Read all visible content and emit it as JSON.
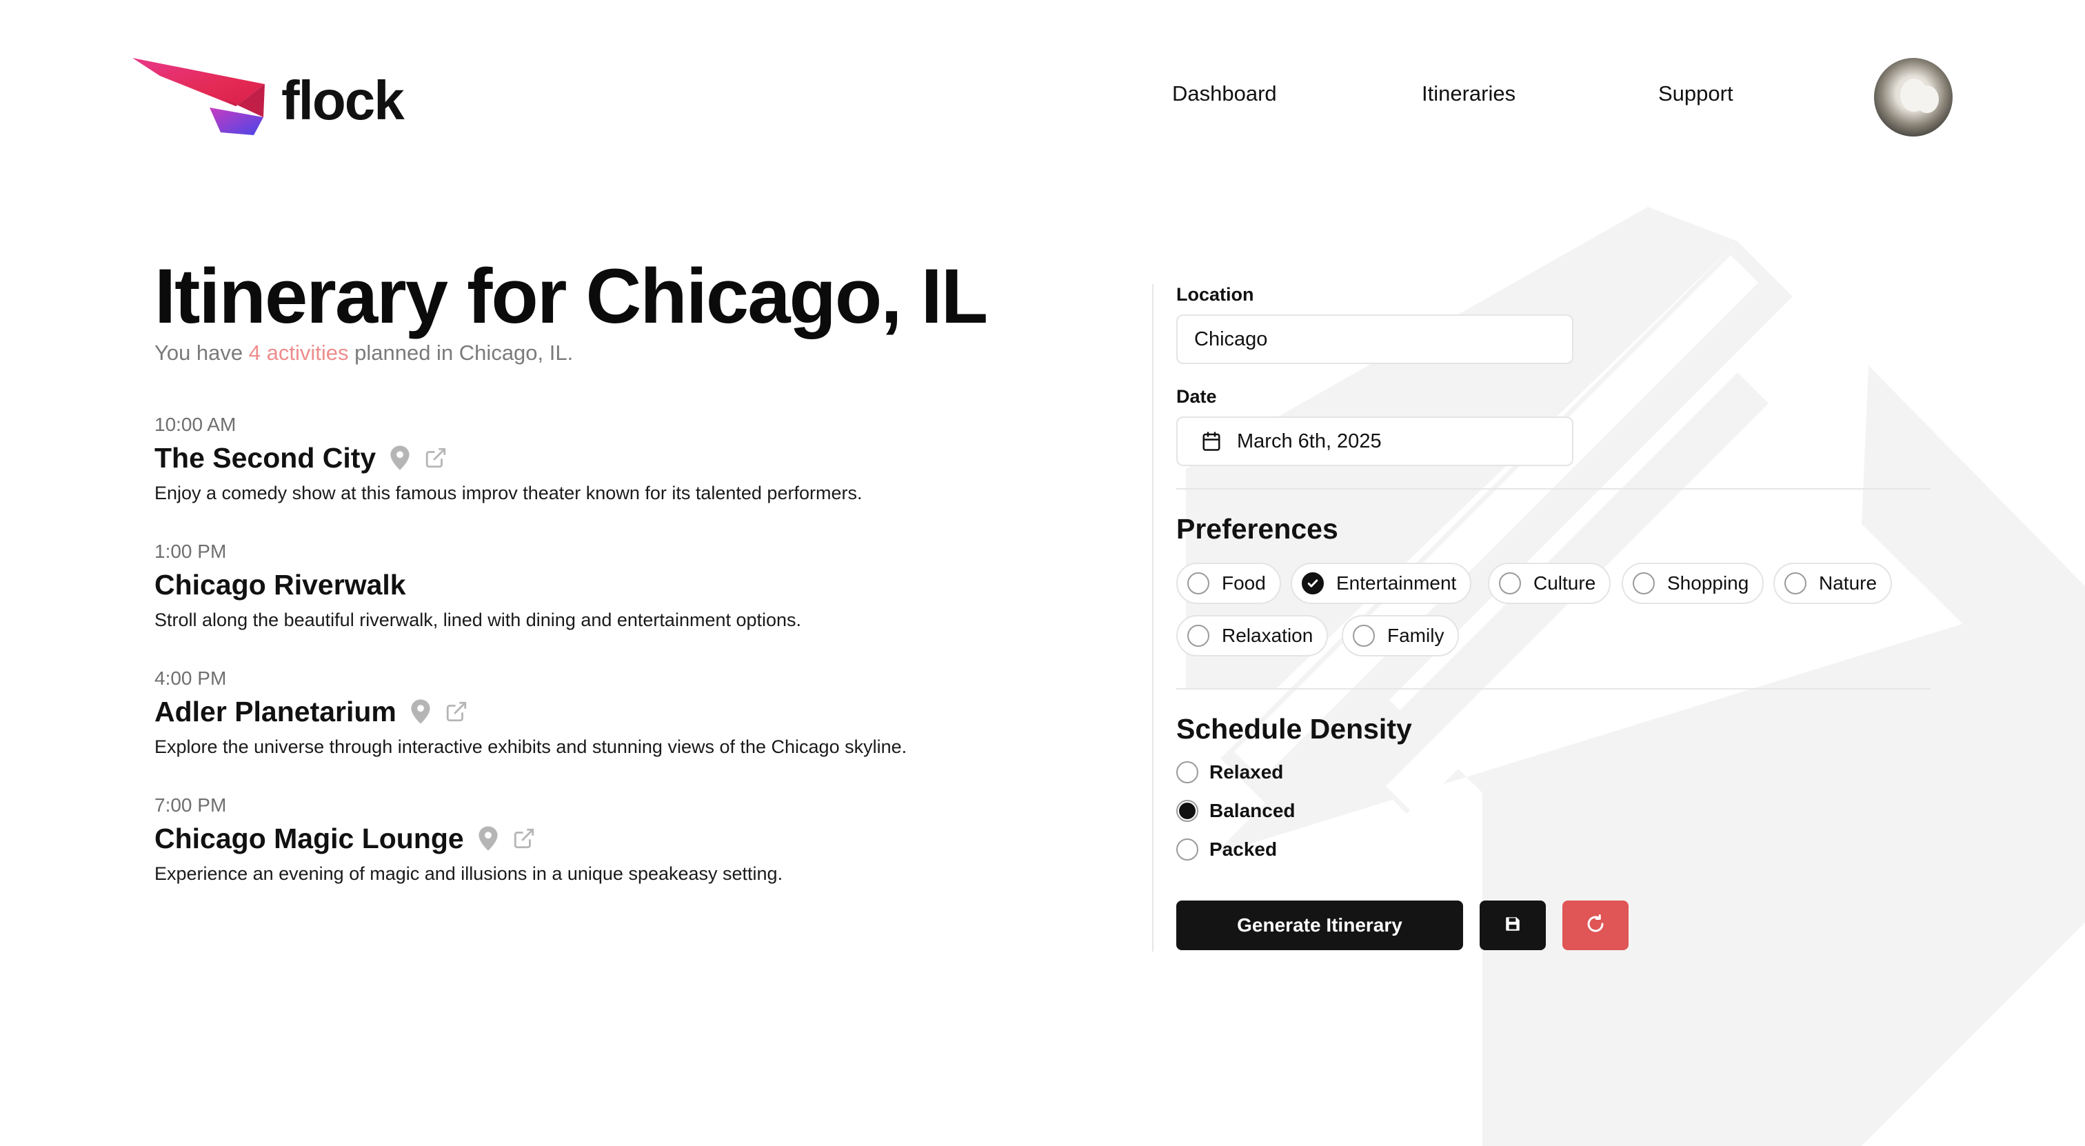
{
  "app": {
    "brand": "flock"
  },
  "nav": {
    "dashboard": "Dashboard",
    "itineraries": "Itineraries",
    "support": "Support"
  },
  "page": {
    "title": "Itinerary for Chicago, IL",
    "subtitle_prefix": "You have ",
    "subtitle_highlight": "4 activities",
    "subtitle_suffix": " planned in Chicago, IL."
  },
  "activities": [
    {
      "time": "10:00 AM",
      "name": "The Second City",
      "description": "Enjoy a comedy show at this famous improv theater known for its talented performers."
    },
    {
      "time": "1:00 PM",
      "name": "Chicago Riverwalk",
      "description": "Stroll along the beautiful riverwalk, lined with dining and entertainment options."
    },
    {
      "time": "4:00 PM",
      "name": "Adler Planetarium",
      "description": "Explore the universe through interactive exhibits and stunning views of the Chicago skyline."
    },
    {
      "time": "7:00 PM",
      "name": "Chicago Magic Lounge",
      "description": "Experience an evening of magic and illusions in a unique speakeasy setting."
    }
  ],
  "form": {
    "location_label": "Location",
    "location_value": "Chicago",
    "date_label": "Date",
    "date_value": "March 6th, 2025",
    "preferences_title": "Preferences",
    "preferences": [
      {
        "label": "Food",
        "checked": false
      },
      {
        "label": "Entertainment",
        "checked": true
      },
      {
        "label": "Culture",
        "checked": false
      },
      {
        "label": "Shopping",
        "checked": false
      },
      {
        "label": "Nature",
        "checked": false
      },
      {
        "label": "Relaxation",
        "checked": false
      },
      {
        "label": "Family",
        "checked": false
      }
    ],
    "density_title": "Schedule Density",
    "density_options": [
      {
        "label": "Relaxed",
        "selected": false
      },
      {
        "label": "Balanced",
        "selected": true
      },
      {
        "label": "Packed",
        "selected": false
      }
    ],
    "generate_label": "Generate Itinerary"
  },
  "icons": {
    "save": "floppy-disk-icon",
    "reset": "refresh-icon",
    "location": "map-pin-icon",
    "external": "external-link-icon",
    "calendar": "calendar-icon"
  },
  "colors": {
    "accent_red": "#e05555",
    "highlight": "#ee8c8c",
    "primary_button": "#141414"
  }
}
